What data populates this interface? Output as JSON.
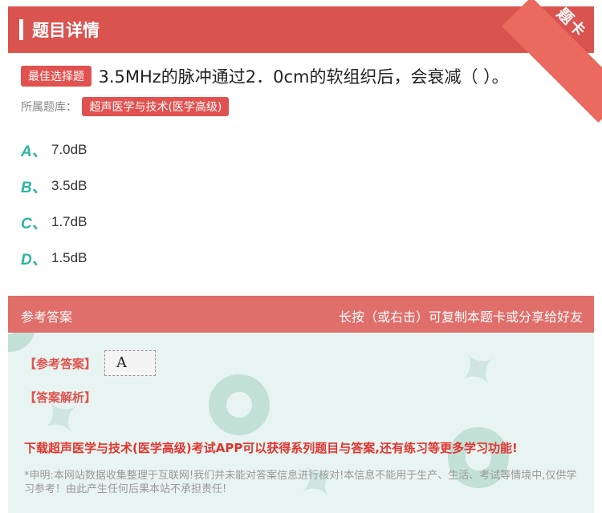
{
  "header": {
    "title": "题目详情",
    "corner_label": "题卡"
  },
  "question": {
    "type_badge": "最佳选择题",
    "text": "3.5MHz的脉冲通过2．0cm的软组织后，会衰减（ ）。",
    "bank_label": "所属题库：",
    "bank_name": "超声医学与技术(医学高级)"
  },
  "options": [
    {
      "letter": "A、",
      "text": "7.0dB"
    },
    {
      "letter": "B、",
      "text": "3.5dB"
    },
    {
      "letter": "C、",
      "text": "1.7dB"
    },
    {
      "letter": "D、",
      "text": "1.5dB"
    }
  ],
  "answer_section": {
    "title": "参考答案",
    "hint": "长按（或右击）可复制本题卡或分享给好友",
    "answer_label": "【参考答案】",
    "answer_value": "A",
    "analysis_label": "【答案解析】",
    "promo": "下载超声医学与技术(医学高级)考试APP可以获得系列题目与答案,还有练习等更多学习功能!",
    "disclaimer": "*申明:本网站数据收集整理于互联网!我们并未能对答案信息进行核对!本信息不能用于生产、生活、考试等情境中,仅供学习参考！由此产生任何后果本站不承担责任!"
  },
  "colors": {
    "brand_red": "#d9534f",
    "accent_teal": "#2ab5a5",
    "answer_bg": "#e8f4f1"
  }
}
